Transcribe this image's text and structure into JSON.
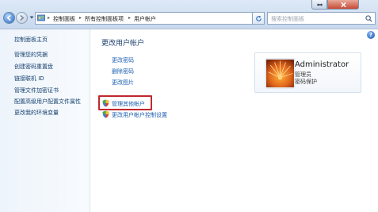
{
  "window": {
    "controls": [
      {
        "name": "restore",
        "icon": "restore-icon"
      },
      {
        "name": "close",
        "icon": "close-icon"
      }
    ]
  },
  "address_bar": {
    "breadcrumbs": [
      "控制面板",
      "所有控制面板项",
      "用户帐户"
    ],
    "search_placeholder": "搜索控制面板"
  },
  "left_pane": {
    "items": [
      {
        "label": "控制面板主页"
      },
      {
        "label": "管理您的凭据"
      },
      {
        "label": "创建密码重置盘"
      },
      {
        "label": "链接联机 ID"
      },
      {
        "label": "管理文件加密证书"
      },
      {
        "label": "配置高级用户配置文件属性"
      },
      {
        "label": "更改我的环境变量"
      }
    ]
  },
  "main": {
    "title": "更改用户帐户",
    "tasks": [
      {
        "label": "更改密码"
      },
      {
        "label": "删除密码"
      },
      {
        "label": "更改图片"
      }
    ],
    "admin_actions": [
      {
        "label": "管理其他帐户",
        "icon": "shield-icon",
        "highlighted": true
      },
      {
        "label": "更改用户帐户控制设置",
        "icon": "shield-icon",
        "highlighted": false
      }
    ]
  },
  "account": {
    "name": "Administrator",
    "role": "管理员",
    "status": "密码保护"
  },
  "colors": {
    "link": "#1c5fb0",
    "highlight_border": "#c0282e",
    "nav_gradient_top": "#dde9f6",
    "close_button": "#c64b35"
  }
}
